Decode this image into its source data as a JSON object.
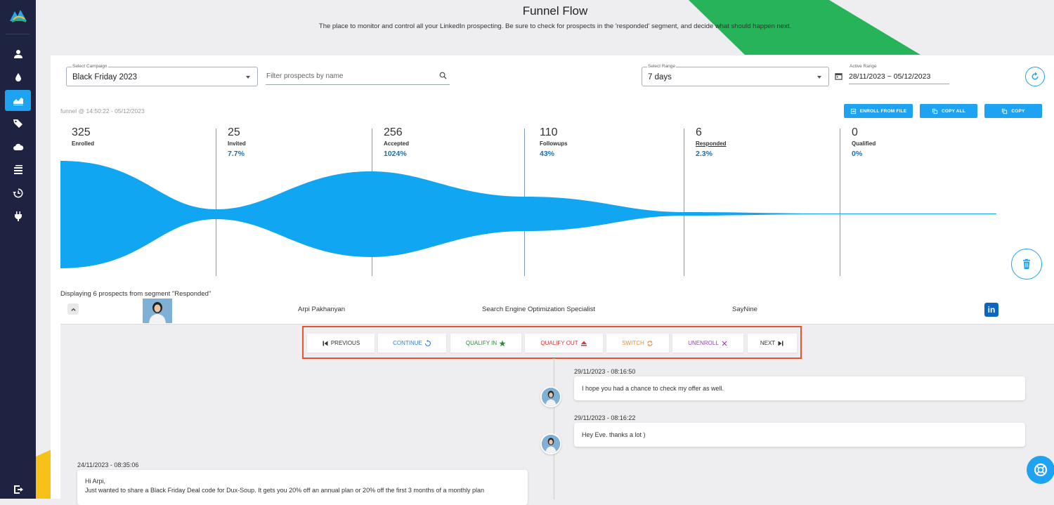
{
  "header": {
    "title": "Funnel Flow",
    "subtitle": "The place to monitor and control all your LinkedIn prospecting. Be sure to check for prospects in the 'responded' segment, and decide what should happen next."
  },
  "sidebar": {
    "items": [
      {
        "icon": "user-icon",
        "active": false
      },
      {
        "icon": "drop-icon",
        "active": false
      },
      {
        "icon": "chart-icon",
        "active": true
      },
      {
        "icon": "tags-icon",
        "active": false
      },
      {
        "icon": "cloud-icon",
        "active": false
      },
      {
        "icon": "list-icon",
        "active": false
      },
      {
        "icon": "history-icon",
        "active": false
      },
      {
        "icon": "plug-icon",
        "active": false
      }
    ],
    "bottom_icon": "logout-icon"
  },
  "filters": {
    "campaign_label": "Select Campaign",
    "campaign_value": "Black Friday 2023",
    "search_placeholder": "Filter prospects by name",
    "range_label": "Select Range",
    "range_value": "7 days",
    "active_range_label": "Active Range",
    "active_range_value": "28/11/2023 ~ 05/12/2023"
  },
  "funnel": {
    "stamp": "funnel @ 14:50:22 - 05/12/2023",
    "buttons": {
      "enroll": "ENROLL FROM FILE",
      "copy_all": "COPY ALL",
      "copy": "COPY"
    },
    "stages": [
      {
        "count": "325",
        "name": "Enrolled",
        "pct": ""
      },
      {
        "count": "25",
        "name": "Invited",
        "pct": "7.7%"
      },
      {
        "count": "256",
        "name": "Accepted",
        "pct": "1024%"
      },
      {
        "count": "110",
        "name": "Followups",
        "pct": "43%"
      },
      {
        "count": "6",
        "name": "Responded",
        "pct": "2.3%"
      },
      {
        "count": "0",
        "name": "Qualified",
        "pct": "0%"
      }
    ],
    "color": "#10a6f2"
  },
  "segment": {
    "text": "Displaying 6 prospects from segment \"Responded\""
  },
  "prospect": {
    "name": "Arpi Pakhanyan",
    "title": "Search Engine Optimization Specialist",
    "company": "SayNine",
    "linkedin_label": "in"
  },
  "actions": {
    "previous": "PREVIOUS",
    "continue": "CONTINUE",
    "qualify_in": "QUALIFY IN",
    "qualify_out": "QUALIFY OUT",
    "switch": "SWITCH",
    "unenroll": "UNENROLL",
    "next": "NEXT"
  },
  "messages": [
    {
      "time": "29/11/2023 - 08:16:50",
      "text": "I hope you had a chance to check my offer as well.",
      "side": "right"
    },
    {
      "time": "29/11/2023 - 08:16:22",
      "text": "Hey Eve. thanks  a lot )",
      "side": "right"
    },
    {
      "time": "24/11/2023 - 08:35:06",
      "text_lines": [
        "Hi Arpi,",
        "Just wanted to share a Black Friday Deal code for Dux-Soup. It gets you 20% off an annual plan or 20% off the first 3 months of a monthly plan"
      ],
      "side": "left"
    }
  ],
  "colors": {
    "sidebar": "#1d2340",
    "accent": "#1ea2f2",
    "highlight_frame": "#e8542e",
    "continue": "#2f7fd0",
    "qualify_in": "#2e8b3e",
    "qualify_out": "#d9343a",
    "switch": "#f08a24",
    "unenroll": "#9b3fb5"
  }
}
